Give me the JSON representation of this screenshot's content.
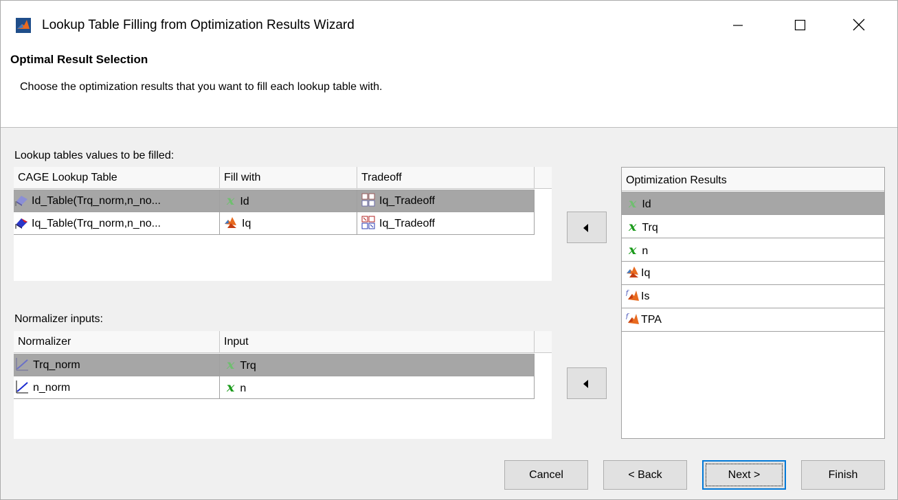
{
  "window": {
    "title": "Lookup Table Filling from Optimization Results Wizard"
  },
  "header": {
    "title": "Optimal Result Selection",
    "description": "Choose the optimization results that you want to fill each lookup table with."
  },
  "lookup": {
    "label": "Lookup tables values to be filled:",
    "columns": [
      "CAGE Lookup Table",
      "Fill with",
      "Tradeoff"
    ],
    "rows": [
      {
        "table": "Id_Table(Trq_norm,n_no...",
        "fill": "Id",
        "fill_icon": "x-variable-icon",
        "tradeoff": "Iq_Tradeoff"
      },
      {
        "table": "Iq_Table(Trq_norm,n_no...",
        "fill": "Iq",
        "fill_icon": "matlab-multi-icon",
        "tradeoff": "Iq_Tradeoff"
      }
    ]
  },
  "normalizer": {
    "label": "Normalizer inputs:",
    "columns": [
      "Normalizer",
      "Input"
    ],
    "rows": [
      {
        "name": "Trq_norm",
        "input": "Trq"
      },
      {
        "name": "n_norm",
        "input": "n"
      }
    ]
  },
  "results": {
    "header": "Optimization Results",
    "items": [
      {
        "label": "Id",
        "icon": "x-variable-icon"
      },
      {
        "label": "Trq",
        "icon": "x-variable-icon"
      },
      {
        "label": "n",
        "icon": "x-variable-icon"
      },
      {
        "label": "Iq",
        "icon": "matlab-multi-icon"
      },
      {
        "label": "Is",
        "icon": "matlab-function-icon"
      },
      {
        "label": "TPA",
        "icon": "matlab-function-icon"
      }
    ]
  },
  "buttons": {
    "cancel": "Cancel",
    "back": "< Back",
    "next": "Next >",
    "finish": "Finish"
  },
  "glyphs": {
    "x": "x"
  }
}
